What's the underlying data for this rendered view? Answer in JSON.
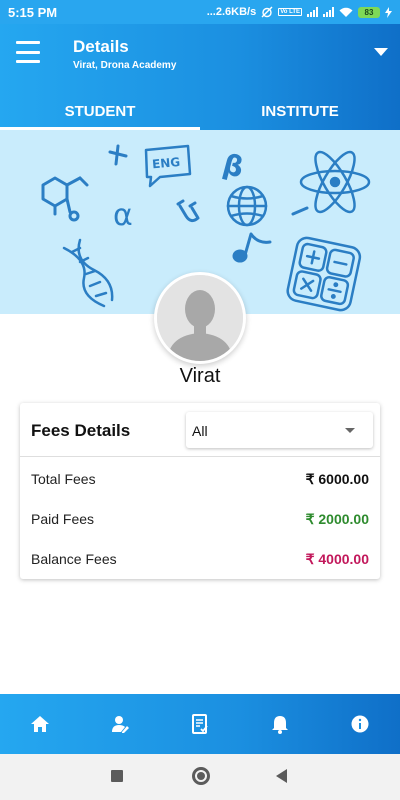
{
  "status_bar": {
    "time": "5:15 PM",
    "network_speed": "...2.6KB/s",
    "volte_tag": "Vo LTE",
    "battery": "83"
  },
  "header": {
    "title": "Details",
    "subtitle": "Virat, Drona Academy"
  },
  "tabs": [
    {
      "label": "STUDENT",
      "active": true
    },
    {
      "label": "INSTITUTE",
      "active": false
    }
  ],
  "banner": {
    "icons": [
      "chemical-structure-icon",
      "plus-icon",
      "eng-speech-bubble-icon",
      "beta-icon",
      "atom-icon",
      "alpha-icon",
      "magnet-icon",
      "globe-icon",
      "minus-icon",
      "dna-icon",
      "music-note-icon",
      "calculator-icon"
    ],
    "text_glyphs": {
      "eng": "ENG",
      "beta": "β",
      "alpha": "α"
    }
  },
  "profile": {
    "name": "Virat",
    "avatar_icon": "person-avatar-icon"
  },
  "fees": {
    "title": "Fees Details",
    "filter_value": "All",
    "rows": [
      {
        "label": "Total Fees",
        "value": "₹ 6000.00",
        "color": "#111111"
      },
      {
        "label": "Paid Fees",
        "value": "₹ 2000.00",
        "color": "#2e8b2e"
      },
      {
        "label": "Balance Fees",
        "value": "₹ 4000.00",
        "color": "#c2185b"
      }
    ]
  },
  "bottom_nav": {
    "items": [
      "home-icon",
      "student-profile-icon",
      "report-icon",
      "notification-bell-icon",
      "info-icon"
    ]
  },
  "colors": {
    "primary": "#1b8fe0",
    "banner_bg": "#c9ecfc",
    "banner_ink": "#2b7ec4"
  }
}
